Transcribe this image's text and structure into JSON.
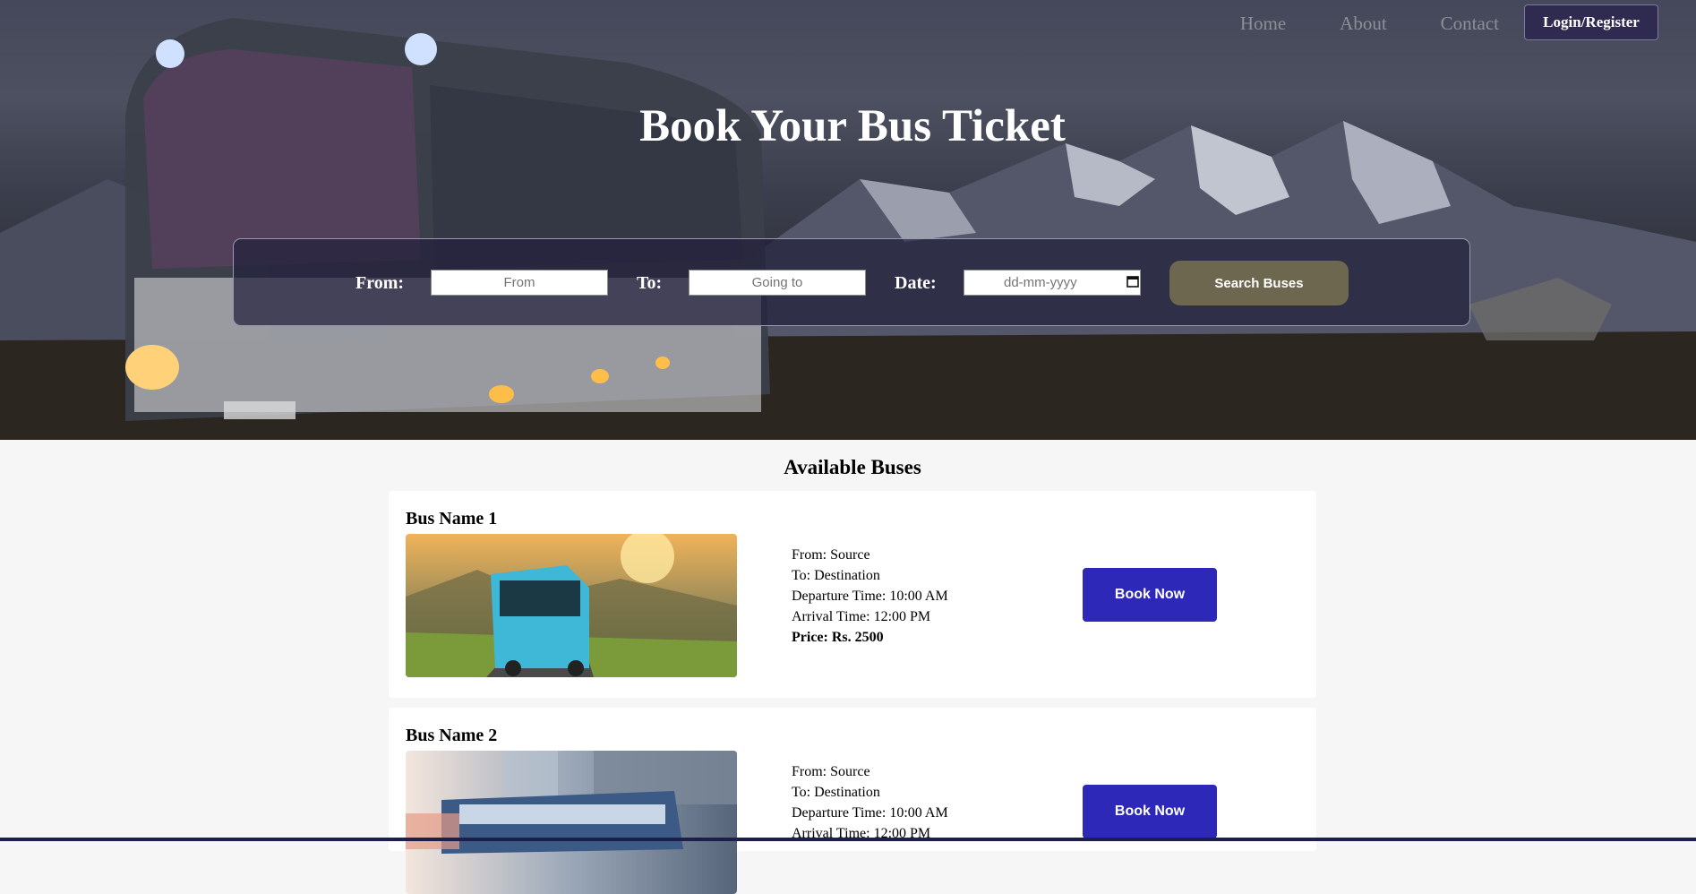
{
  "nav": {
    "items": [
      "Home",
      "About",
      "Contact"
    ],
    "login_label": "Login/Register"
  },
  "hero": {
    "title": "Book Your Bus Ticket"
  },
  "search": {
    "from_label": "From:",
    "from_placeholder": "From",
    "to_label": "To:",
    "to_placeholder": "Going to",
    "date_label": "Date:",
    "date_placeholder": "dd-mm-yyyy",
    "button_label": "Search Buses"
  },
  "list": {
    "title": "Available Buses",
    "buses": [
      {
        "name": "Bus Name 1",
        "from": "From: Source",
        "to": "To: Destination",
        "departure": "Departure Time: 10:00 AM",
        "arrival": "Arrival Time: 12:00 PM",
        "price": "Price: Rs. 2500",
        "button": "Book Now"
      },
      {
        "name": "Bus Name 2",
        "from": "From: Source",
        "to": "To: Destination",
        "departure": "Departure Time: 10:00 AM",
        "arrival": "Arrival Time: 12:00 PM",
        "button": "Book Now"
      }
    ]
  },
  "colors": {
    "login_bg": "#2f2a50",
    "search_button": "#6e6750",
    "book_button": "#2d28b8",
    "page_bg": "#f6f6f6"
  }
}
